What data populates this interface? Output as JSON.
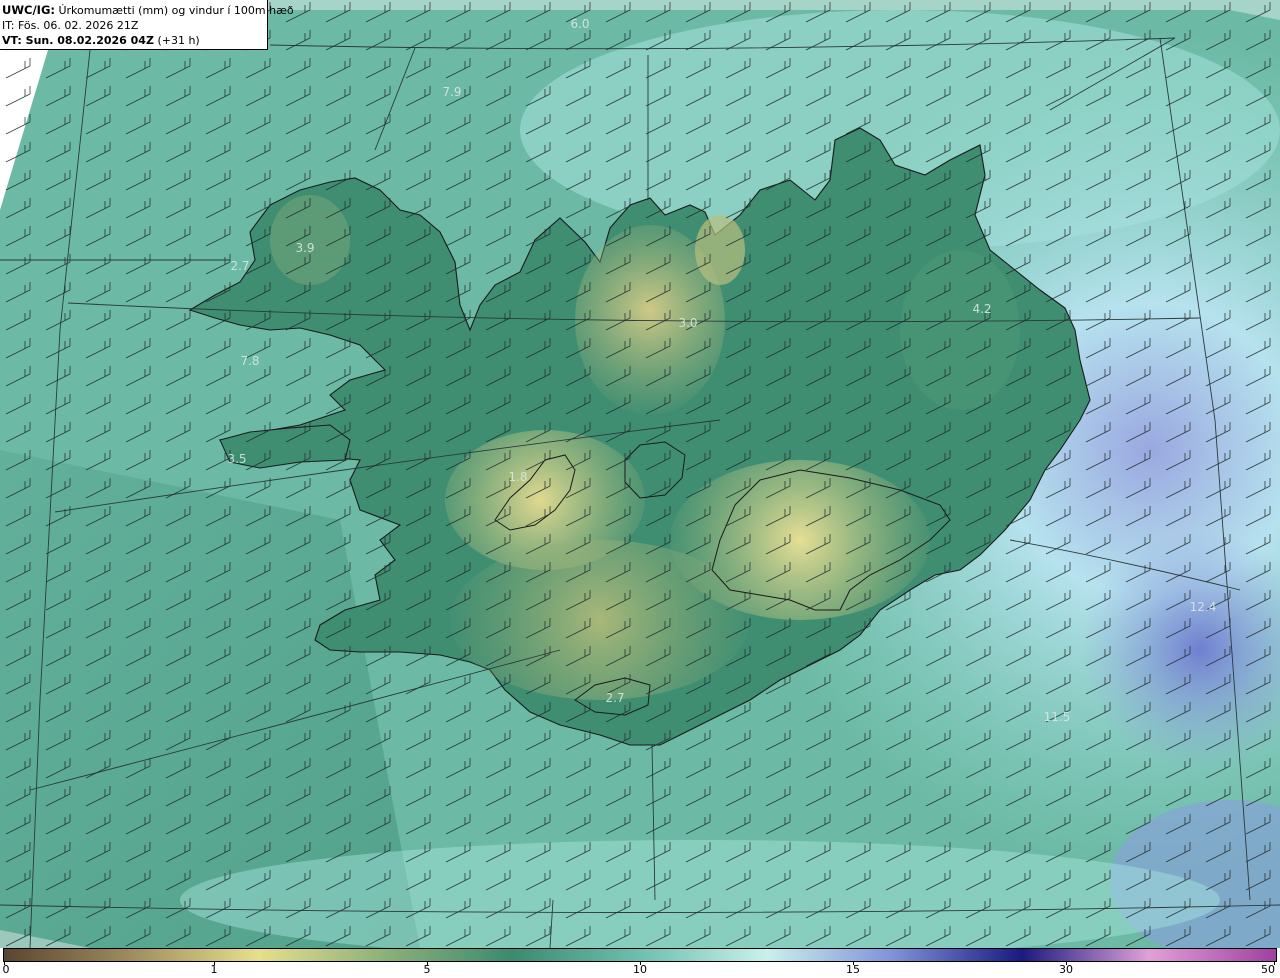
{
  "header": {
    "model": "UWC/IG:",
    "title": "Úrkomumætti (mm) og vindur í 100m hæð",
    "initial_time": "IT: Fös. 06. 02. 2026 21Z",
    "valid_prefix": "VT: Sun. 08.02.2026 04Z",
    "valid_offset": "(+31 h)"
  },
  "value_labels": [
    "6.0",
    "7.9",
    "3.9",
    "2.7",
    "7.8",
    "3.5",
    "3.0",
    "4.2",
    "1.8",
    "2.7",
    "12.4",
    "11.5"
  ],
  "colorbar": {
    "ticks": [
      "0",
      "1",
      "5",
      "10",
      "15",
      "30",
      "50"
    ],
    "colors": [
      "#5a4630",
      "#a08c5e",
      "#e6df8e",
      "#8cb07a",
      "#3c8a70",
      "#6fbfb0",
      "#c9f0ec",
      "#8090d8",
      "#1a1a80",
      "#e0a0d8",
      "#a040a0"
    ]
  },
  "colors": {
    "land_low": "#3c8a70",
    "land_dry": "#d9d48a",
    "sea": "#8fd6cc",
    "high_precip": "#7f8fd6"
  }
}
